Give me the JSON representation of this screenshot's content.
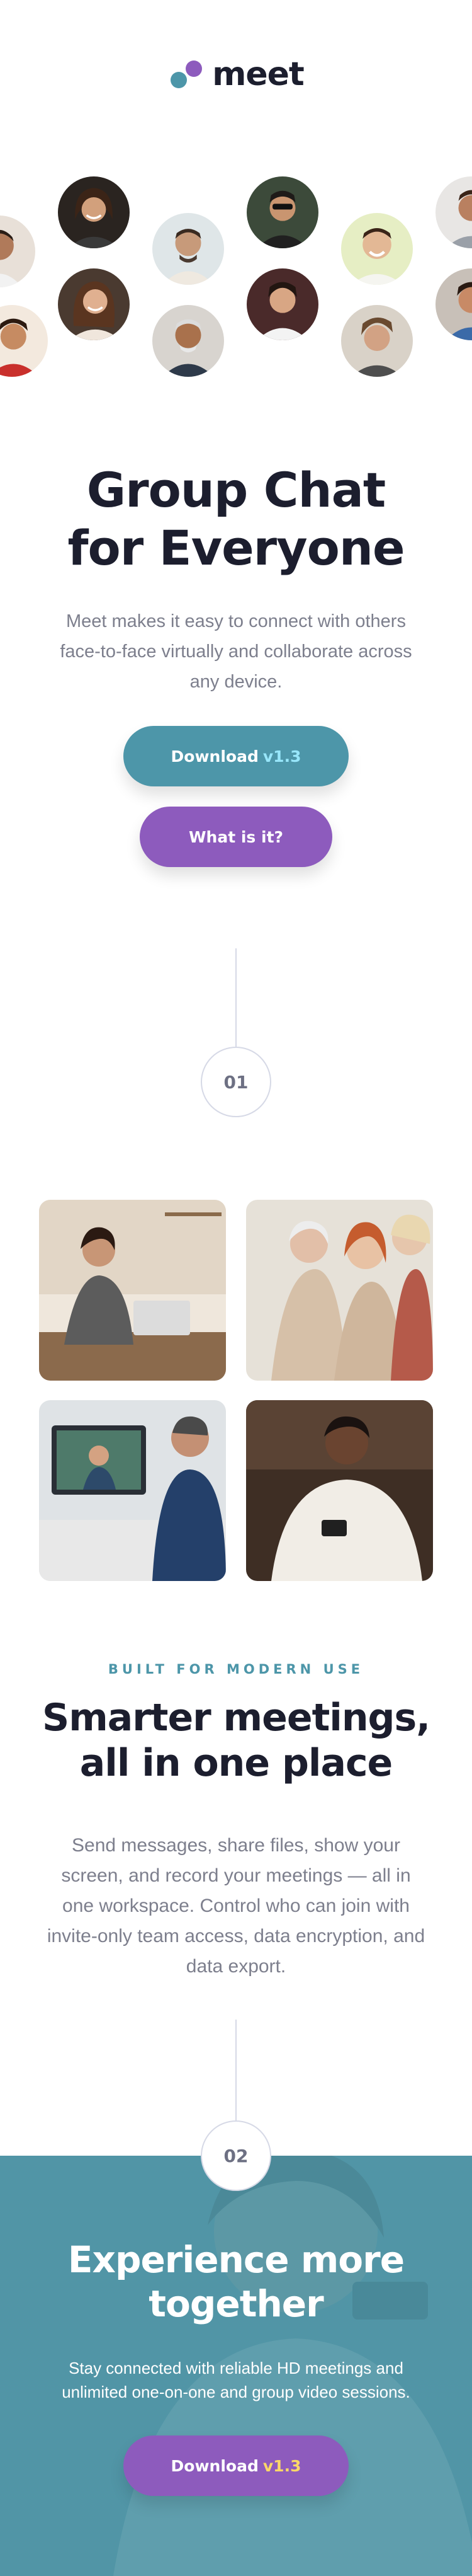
{
  "header": {
    "logo_text": "meet",
    "logo_colors": {
      "left_dot": "#4d96a9",
      "right_dot": "#8d5bbd"
    }
  },
  "avatars": {
    "count": 12,
    "icon": "person-photo"
  },
  "hero": {
    "title_line1": "Group Chat",
    "title_line2": "for Everyone",
    "description": "Meet makes it easy to connect with others face-to-face virtually and collaborate across any device.",
    "download_label": "Download",
    "download_version": "v1.3",
    "whatis_label": "What is it?"
  },
  "steps": {
    "first": "01",
    "second": "02"
  },
  "features": {
    "eyebrow": "BUILT FOR MODERN USE",
    "title_line1": "Smarter meetings,",
    "title_line2": "all in one place",
    "description": "Send messages, share files, show your screen, and record your meetings — all in one workspace. Control who can join with invite-only team access, data encryption, and data export."
  },
  "cta": {
    "title_line1": "Experience more",
    "title_line2": "together",
    "description": "Stay connected with reliable HD meetings and unlimited one-on-one and group video sessions.",
    "download_label": "Download",
    "download_version": "v1.3"
  },
  "colors": {
    "accent_teal": "#4d96a9",
    "accent_purple": "#8d5bbd",
    "heading": "#1c1e2e",
    "body_text": "#7d7f8d"
  }
}
